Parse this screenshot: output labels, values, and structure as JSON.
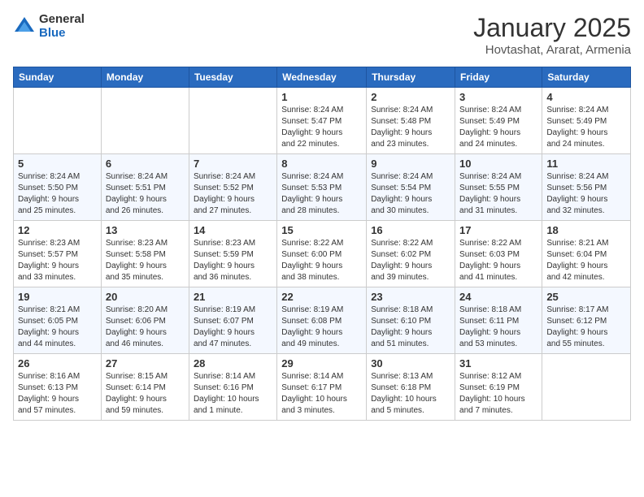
{
  "logo": {
    "general": "General",
    "blue": "Blue"
  },
  "title": "January 2025",
  "location": "Hovtashat, Ararat, Armenia",
  "days_header": [
    "Sunday",
    "Monday",
    "Tuesday",
    "Wednesday",
    "Thursday",
    "Friday",
    "Saturday"
  ],
  "weeks": [
    [
      {
        "num": "",
        "info": ""
      },
      {
        "num": "",
        "info": ""
      },
      {
        "num": "",
        "info": ""
      },
      {
        "num": "1",
        "info": "Sunrise: 8:24 AM\nSunset: 5:47 PM\nDaylight: 9 hours\nand 22 minutes."
      },
      {
        "num": "2",
        "info": "Sunrise: 8:24 AM\nSunset: 5:48 PM\nDaylight: 9 hours\nand 23 minutes."
      },
      {
        "num": "3",
        "info": "Sunrise: 8:24 AM\nSunset: 5:49 PM\nDaylight: 9 hours\nand 24 minutes."
      },
      {
        "num": "4",
        "info": "Sunrise: 8:24 AM\nSunset: 5:49 PM\nDaylight: 9 hours\nand 24 minutes."
      }
    ],
    [
      {
        "num": "5",
        "info": "Sunrise: 8:24 AM\nSunset: 5:50 PM\nDaylight: 9 hours\nand 25 minutes."
      },
      {
        "num": "6",
        "info": "Sunrise: 8:24 AM\nSunset: 5:51 PM\nDaylight: 9 hours\nand 26 minutes."
      },
      {
        "num": "7",
        "info": "Sunrise: 8:24 AM\nSunset: 5:52 PM\nDaylight: 9 hours\nand 27 minutes."
      },
      {
        "num": "8",
        "info": "Sunrise: 8:24 AM\nSunset: 5:53 PM\nDaylight: 9 hours\nand 28 minutes."
      },
      {
        "num": "9",
        "info": "Sunrise: 8:24 AM\nSunset: 5:54 PM\nDaylight: 9 hours\nand 30 minutes."
      },
      {
        "num": "10",
        "info": "Sunrise: 8:24 AM\nSunset: 5:55 PM\nDaylight: 9 hours\nand 31 minutes."
      },
      {
        "num": "11",
        "info": "Sunrise: 8:24 AM\nSunset: 5:56 PM\nDaylight: 9 hours\nand 32 minutes."
      }
    ],
    [
      {
        "num": "12",
        "info": "Sunrise: 8:23 AM\nSunset: 5:57 PM\nDaylight: 9 hours\nand 33 minutes."
      },
      {
        "num": "13",
        "info": "Sunrise: 8:23 AM\nSunset: 5:58 PM\nDaylight: 9 hours\nand 35 minutes."
      },
      {
        "num": "14",
        "info": "Sunrise: 8:23 AM\nSunset: 5:59 PM\nDaylight: 9 hours\nand 36 minutes."
      },
      {
        "num": "15",
        "info": "Sunrise: 8:22 AM\nSunset: 6:00 PM\nDaylight: 9 hours\nand 38 minutes."
      },
      {
        "num": "16",
        "info": "Sunrise: 8:22 AM\nSunset: 6:02 PM\nDaylight: 9 hours\nand 39 minutes."
      },
      {
        "num": "17",
        "info": "Sunrise: 8:22 AM\nSunset: 6:03 PM\nDaylight: 9 hours\nand 41 minutes."
      },
      {
        "num": "18",
        "info": "Sunrise: 8:21 AM\nSunset: 6:04 PM\nDaylight: 9 hours\nand 42 minutes."
      }
    ],
    [
      {
        "num": "19",
        "info": "Sunrise: 8:21 AM\nSunset: 6:05 PM\nDaylight: 9 hours\nand 44 minutes."
      },
      {
        "num": "20",
        "info": "Sunrise: 8:20 AM\nSunset: 6:06 PM\nDaylight: 9 hours\nand 46 minutes."
      },
      {
        "num": "21",
        "info": "Sunrise: 8:19 AM\nSunset: 6:07 PM\nDaylight: 9 hours\nand 47 minutes."
      },
      {
        "num": "22",
        "info": "Sunrise: 8:19 AM\nSunset: 6:08 PM\nDaylight: 9 hours\nand 49 minutes."
      },
      {
        "num": "23",
        "info": "Sunrise: 8:18 AM\nSunset: 6:10 PM\nDaylight: 9 hours\nand 51 minutes."
      },
      {
        "num": "24",
        "info": "Sunrise: 8:18 AM\nSunset: 6:11 PM\nDaylight: 9 hours\nand 53 minutes."
      },
      {
        "num": "25",
        "info": "Sunrise: 8:17 AM\nSunset: 6:12 PM\nDaylight: 9 hours\nand 55 minutes."
      }
    ],
    [
      {
        "num": "26",
        "info": "Sunrise: 8:16 AM\nSunset: 6:13 PM\nDaylight: 9 hours\nand 57 minutes."
      },
      {
        "num": "27",
        "info": "Sunrise: 8:15 AM\nSunset: 6:14 PM\nDaylight: 9 hours\nand 59 minutes."
      },
      {
        "num": "28",
        "info": "Sunrise: 8:14 AM\nSunset: 6:16 PM\nDaylight: 10 hours\nand 1 minute."
      },
      {
        "num": "29",
        "info": "Sunrise: 8:14 AM\nSunset: 6:17 PM\nDaylight: 10 hours\nand 3 minutes."
      },
      {
        "num": "30",
        "info": "Sunrise: 8:13 AM\nSunset: 6:18 PM\nDaylight: 10 hours\nand 5 minutes."
      },
      {
        "num": "31",
        "info": "Sunrise: 8:12 AM\nSunset: 6:19 PM\nDaylight: 10 hours\nand 7 minutes."
      },
      {
        "num": "",
        "info": ""
      }
    ]
  ]
}
